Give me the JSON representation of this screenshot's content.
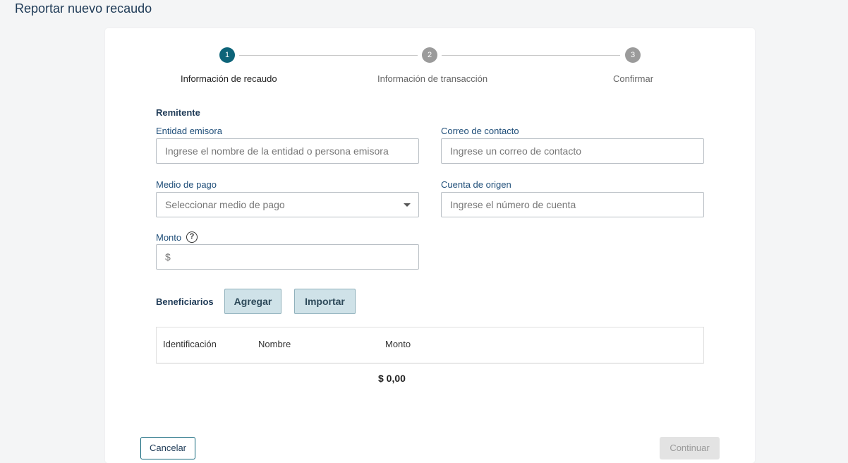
{
  "page": {
    "title": "Reportar nuevo recaudo"
  },
  "stepper": {
    "steps": [
      {
        "number": "1",
        "label": "Información de recaudo"
      },
      {
        "number": "2",
        "label": "Información de transacción"
      },
      {
        "number": "3",
        "label": "Confirmar"
      }
    ],
    "active_step": 1
  },
  "remitente": {
    "title": "Remitente",
    "entidad": {
      "label": "Entidad emisora",
      "placeholder": "Ingrese el nombre de la entidad o persona emisora"
    },
    "correo": {
      "label": "Correo de contacto",
      "placeholder": "Ingrese un correo de contacto"
    },
    "medio_pago": {
      "label": "Medio de pago",
      "placeholder": "Seleccionar medio de pago"
    },
    "cuenta_origen": {
      "label": "Cuenta de origen",
      "placeholder": "Ingrese el número de cuenta"
    },
    "monto": {
      "label": "Monto",
      "help_icon": "?",
      "prefix": "$"
    }
  },
  "beneficiarios": {
    "title": "Beneficiarios",
    "add_label": "Agregar",
    "import_label": "Importar",
    "columns": [
      "Identificación",
      "Nombre",
      "Monto"
    ],
    "total": "$ 0,00"
  },
  "footer": {
    "cancel_label": "Cancelar",
    "continue_label": "Continuar"
  },
  "colors": {
    "accent": "#0d6479",
    "inactive_step": "#9b9b9b",
    "title": "#1f3b57"
  }
}
